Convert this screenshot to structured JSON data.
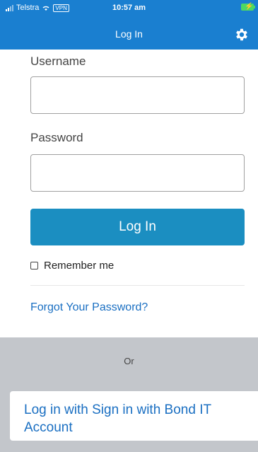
{
  "status_bar": {
    "carrier": "Telstra",
    "vpn": "VPN",
    "time": "10:57 am"
  },
  "nav": {
    "title": "Log In",
    "settings_icon": "gear-icon"
  },
  "form": {
    "username_label": "Username",
    "username_value": "",
    "password_label": "Password",
    "password_value": "",
    "login_button": "Log In",
    "remember_label": "Remember me",
    "remember_checked": false,
    "forgot_link": "Forgot Your Password?"
  },
  "alt_login": {
    "or_text": "Or",
    "sso_button": "Log in with Sign in with Bond IT Account"
  },
  "colors": {
    "nav_bg": "#1a7fd0",
    "button_bg": "#1b8ec1",
    "link": "#1a6fc2",
    "gray_area": "#c3c6cb"
  }
}
